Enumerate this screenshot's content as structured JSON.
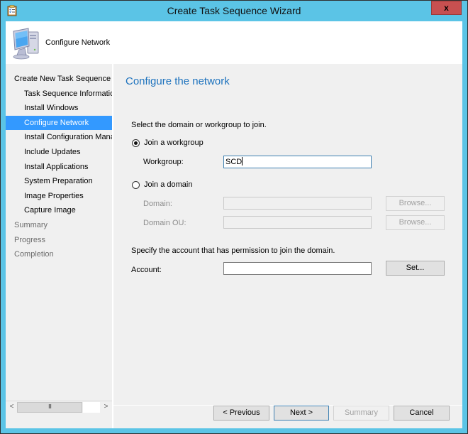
{
  "window": {
    "title": "Create Task Sequence Wizard",
    "title_icon": "task-list-clipboard-icon",
    "close_label": "x"
  },
  "header": {
    "icon": "computer-monitor-icon",
    "title": "Configure Network"
  },
  "nav": {
    "items": [
      {
        "label": "Create New Task Sequence",
        "level": "top",
        "state": "done"
      },
      {
        "label": "Task Sequence Information",
        "level": "sub",
        "state": "done"
      },
      {
        "label": "Install Windows",
        "level": "sub",
        "state": "done"
      },
      {
        "label": "Configure Network",
        "level": "sub",
        "state": "selected"
      },
      {
        "label": "Install Configuration Manager",
        "level": "sub",
        "state": "done"
      },
      {
        "label": "Include Updates",
        "level": "sub",
        "state": "done"
      },
      {
        "label": "Install Applications",
        "level": "sub",
        "state": "done"
      },
      {
        "label": "System Preparation",
        "level": "sub",
        "state": "done"
      },
      {
        "label": "Image Properties",
        "level": "sub",
        "state": "done"
      },
      {
        "label": "Capture Image",
        "level": "sub",
        "state": "done"
      },
      {
        "label": "Summary",
        "level": "top",
        "state": "future"
      },
      {
        "label": "Progress",
        "level": "top",
        "state": "future"
      },
      {
        "label": "Completion",
        "level": "top",
        "state": "future"
      }
    ],
    "scrollbar": {
      "left_arrow": "<",
      "thumb_grip": "III",
      "right_arrow": ">"
    }
  },
  "main": {
    "heading": "Configure the network",
    "instruction": "Select the domain or workgroup to join.",
    "workgroup_option": {
      "label": "Join a workgroup",
      "checked": true
    },
    "workgroup_field": {
      "label": "Workgroup:",
      "value": "SCD"
    },
    "domain_option": {
      "label": "Join a domain",
      "checked": false
    },
    "domain_field": {
      "label": "Domain:",
      "value": "",
      "browse_label": "Browse..."
    },
    "domain_ou_field": {
      "label": "Domain OU:",
      "value": "",
      "browse_label": "Browse..."
    },
    "account_instruction": "Specify the account that has permission to join the domain.",
    "account_field": {
      "label": "Account:",
      "value": "",
      "set_label": "Set..."
    }
  },
  "footer": {
    "previous_label": "< Previous",
    "next_label": "Next >",
    "summary_label": "Summary",
    "cancel_label": "Cancel"
  },
  "colors": {
    "frame": "#5bc4e6",
    "selection": "#3399ff",
    "heading": "#1e73be",
    "close_button": "#c75050"
  }
}
